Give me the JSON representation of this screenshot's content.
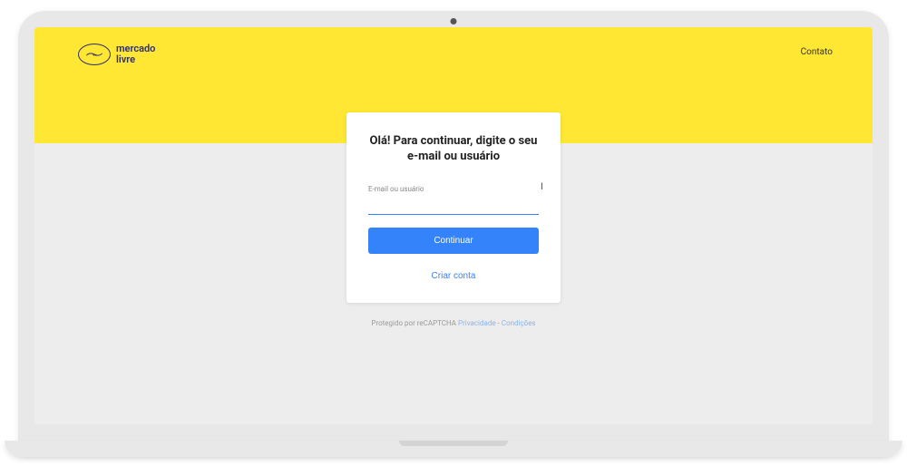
{
  "brand": {
    "line1": "mercado",
    "line2": "livre"
  },
  "header": {
    "contact_label": "Contato"
  },
  "card": {
    "title": "Olá! Para continuar, digite o seu e-mail ou usuário",
    "field_label": "E-mail ou usuário",
    "field_value": "",
    "continue_label": "Continuar",
    "create_account_label": "Criar conta"
  },
  "footer": {
    "prefix": "Protegido por reCAPTCHA ",
    "privacy_label": "Privacidade",
    "sep": " - ",
    "terms_label": "Condições"
  }
}
